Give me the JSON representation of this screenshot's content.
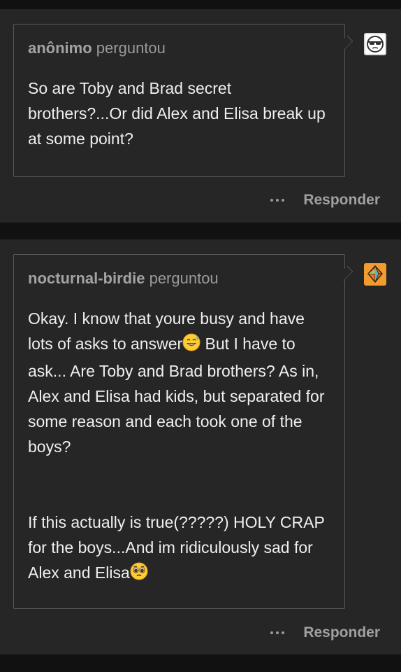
{
  "posts": [
    {
      "asker_name": "anônimo",
      "asked_label": "perguntou",
      "avatar_icon": "anonymous-sunglasses-icon",
      "question_paragraphs": [
        "So are Toby and Brad secret brothers?...Or did Alex and Elisa break up at some point?"
      ],
      "reply_label": "Responder"
    },
    {
      "asker_name": "nocturnal-birdie",
      "asked_label": "perguntou",
      "avatar_icon": "bird-avatar-icon",
      "question_part1": "Okay. I know that youre busy and have lots of asks to answer",
      "question_part1_after": " But I have to ask... Are Toby and Brad brothers? As in, Alex and Elisa had kids, but separated for some reason and each took one of the boys?",
      "question_part2": "If this actually is true(?????)  HOLY CRAP for the boys...And im ridiculously sad for Alex and Elisa",
      "emoji_1": "grinning-sweat-emoji",
      "emoji_2": "pleading-face-emoji",
      "reply_label": "Responder"
    }
  ],
  "colors": {
    "page_bg": "#111111",
    "card_bg": "#262626",
    "text": "#efefef",
    "muted": "#9a9a9a",
    "bird_avatar": "#f39c2e"
  }
}
